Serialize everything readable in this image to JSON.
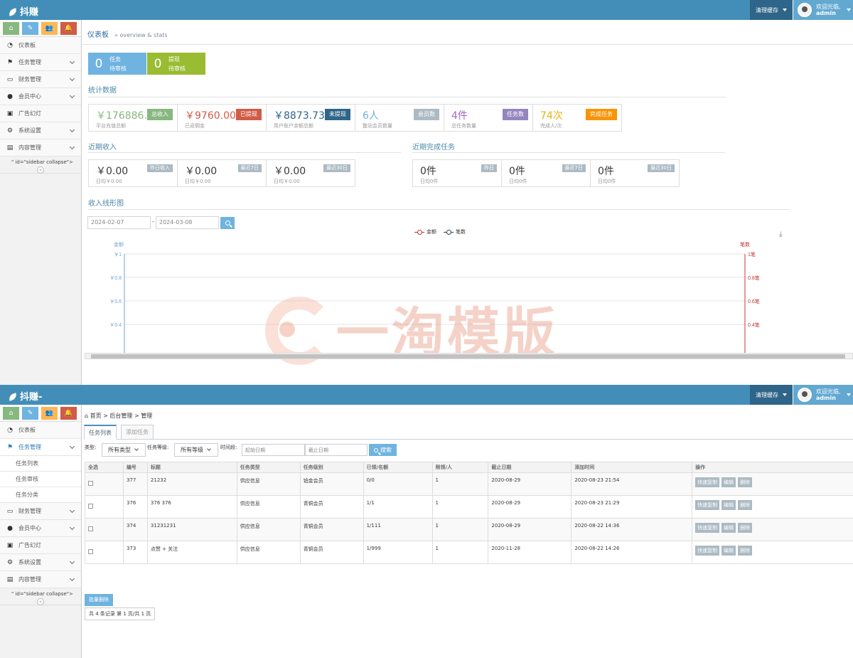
{
  "panel1": {
    "brand": "抖赚",
    "cache_label": "清理缓存",
    "welcome": "欢迎光临,",
    "username": "admin",
    "shortcuts": [
      "home-icon",
      "pencil-icon",
      "users-icon",
      "bell-icon"
    ],
    "menu": [
      {
        "label": "仪表板",
        "icon": "dashboard-icon"
      },
      {
        "label": "任务管理",
        "icon": "flag-icon"
      },
      {
        "label": "财务管理",
        "icon": "inbox-icon"
      },
      {
        "label": "会员中心",
        "icon": "user-icon"
      },
      {
        "label": "广告幻灯",
        "icon": "picture-icon"
      },
      {
        "label": "系统设置",
        "icon": "gear-icon"
      },
      {
        "label": "内容管理",
        "icon": "book-icon"
      }
    ],
    "sidebar_code_text": "\" id=\"sidebar collapse\">",
    "breadcrumb": "仪表板",
    "breadcrumb_sub": "» overview & stats",
    "tiles": [
      {
        "num": "0",
        "line1": "任务",
        "line2": "待审核",
        "color": "#6fb3e0"
      },
      {
        "num": "0",
        "line1": "提现",
        "line2": "待审核",
        "color": "#9abc32"
      }
    ],
    "stats_title": "统计数据",
    "stats": [
      {
        "value": "￥176886.0",
        "label": "平台充值总额",
        "tag": "总收入",
        "color": "#87b87f"
      },
      {
        "value": "￥9760.00",
        "label": "已返佣金",
        "tag": "已提现",
        "color": "#d15b47"
      },
      {
        "value": "￥8873.73",
        "label": "用户账户余额总额",
        "tag": "未提现",
        "color": "#2e6589"
      },
      {
        "value": "6人",
        "label": "整站会员数量",
        "tag": "会员数",
        "color": "#6fb3e0",
        "tagcolor": "#abbac3"
      },
      {
        "value": "4件",
        "label": "总任务数量",
        "tag": "任务数",
        "color": "#a069c3",
        "tagcolor": "#9585bf"
      },
      {
        "value": "74次",
        "label": "完成人/次",
        "tag": "完成任务",
        "color": "#e8b110",
        "tagcolor": "#f89406"
      }
    ],
    "income_title": "近期收入",
    "income": [
      {
        "value": "￥0.00",
        "tag": "昨日收入",
        "sub": "日均￥0.00"
      },
      {
        "value": "￥0.00",
        "tag": "最近7日",
        "sub": "日均￥0.00"
      },
      {
        "value": "￥0.00",
        "tag": "最近30日",
        "sub": "日均￥0.00"
      }
    ],
    "tasks_title": "近期完成任务",
    "tasks": [
      {
        "value": "0件",
        "tag": "昨日",
        "sub": "日均0件"
      },
      {
        "value": "0件",
        "tag": "最近7日",
        "sub": "日均0件"
      },
      {
        "value": "0件",
        "tag": "最近30日",
        "sub": "日均0件"
      }
    ],
    "chart_section_title": "收入线形图",
    "date_from": "2024-02-07",
    "date_sep": "-",
    "date_to": "2024-03-08",
    "watermark": "一淘模版"
  },
  "chart_data": {
    "type": "line",
    "series": [
      {
        "name": "金额",
        "color": "#c23531",
        "values": []
      },
      {
        "name": "笔数",
        "color": "#2f4554",
        "values": []
      }
    ],
    "y_left_label": "金额",
    "y_right_label": "笔数",
    "y_left_ticks": [
      "￥1",
      "￥0.8",
      "￥0.6",
      "￥0.4"
    ],
    "y_right_ticks": [
      "1笔",
      "0.8笔",
      "0.6笔",
      "0.4笔"
    ],
    "ylim": [
      0,
      1
    ],
    "grid": true,
    "legend_position": "top-center"
  },
  "panel2": {
    "brand": "抖赚-",
    "cache_label": "清理缓存",
    "welcome": "欢迎光临,",
    "username": "admin",
    "menu_top": {
      "label": "仪表板"
    },
    "menu_active": {
      "label": "任务管理"
    },
    "submenu": [
      "任务列表",
      "任务审核",
      "任务分类"
    ],
    "menu_rest": [
      {
        "label": "财务管理"
      },
      {
        "label": "会员中心"
      },
      {
        "label": "广告幻灯"
      },
      {
        "label": "系统设置"
      },
      {
        "label": "内容管理"
      }
    ],
    "sidebar_code_text": "\" id=\"sidebar collapse\">",
    "breadcrumb": "首页 > 后台管理 > 管理",
    "tabs": [
      "任务列表",
      "添加任务"
    ],
    "filter": {
      "type_label": "类型:",
      "type_value": "所有类型",
      "level_label": "任务等级:",
      "level_value": "所有等级",
      "time_label": "时间段:",
      "start_placeholder": "起始日期",
      "end_placeholder": "截止日期",
      "search": "搜索"
    },
    "table": {
      "headers": [
        "全选",
        "编号",
        "标题",
        "任务类型",
        "任务级别",
        "已领/名额",
        "限领/人",
        "截止日期",
        "添加时间",
        "操作"
      ],
      "rows": [
        [
          "",
          "377",
          "21232",
          "供应信息",
          "铂金会员",
          "0/0",
          "1",
          "2020-08-29",
          "2020-08-23 21:54"
        ],
        [
          "",
          "376",
          "376    376",
          "供应信息",
          "青铜会员",
          "1/1",
          "1",
          "2020-08-29",
          "2020-08-23 21:29"
        ],
        [
          "",
          "374",
          "31231231",
          "供应信息",
          "青铜会员",
          "1/111",
          "1",
          "2020-08-29",
          "2020-08-22 14:36"
        ],
        [
          "",
          "373",
          "点赞 + 关注",
          "供应信息",
          "青铜会员",
          "1/999",
          "1",
          "2020-11-28",
          "2020-08-22 14:26"
        ]
      ],
      "ops": [
        "快速复制",
        "编辑",
        "删除"
      ]
    },
    "bulk_delete": "批量删除",
    "pager": "共 4 条记录 第 1 页/共 1 页"
  }
}
